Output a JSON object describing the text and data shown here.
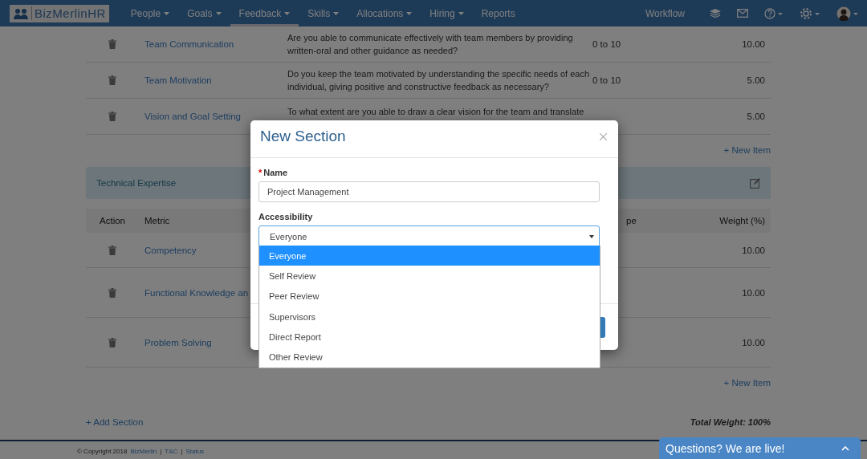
{
  "nav": {
    "logo": "BizMerlinHR",
    "items": [
      {
        "label": "People",
        "dropdown": true,
        "selected": false
      },
      {
        "label": "Goals",
        "dropdown": true,
        "selected": false
      },
      {
        "label": "Feedback",
        "dropdown": true,
        "selected": true
      },
      {
        "label": "Skills",
        "dropdown": true,
        "selected": false
      },
      {
        "label": "Allocations",
        "dropdown": true,
        "selected": false
      },
      {
        "label": "Hiring",
        "dropdown": true,
        "selected": false
      },
      {
        "label": "Reports",
        "dropdown": false,
        "selected": false
      }
    ],
    "workflow": "Workflow"
  },
  "first_section": {
    "rows": [
      {
        "metric": "Team Communication",
        "description": "Are you able to communicate effectively with team members by providing written-oral and other guidance as needed?",
        "scale": "0 to 10",
        "weight": "10.00"
      },
      {
        "metric": "Team Motivation",
        "description": "Do you keep the team motivated by understanding the specific needs of each individual, giving positive and constructive feedback as necessary?",
        "scale": "0 to 10",
        "weight": "5.00"
      },
      {
        "metric": "Vision and Goal Setting",
        "description": "To what extent are you able to draw a clear vision for the team and translate",
        "weight": "5.00"
      }
    ],
    "new_item": "+ New Item"
  },
  "technical_section": {
    "title": "Technical Expertise",
    "columns": [
      "Action",
      "Metric",
      "pe",
      "Weight (%)"
    ],
    "rows": [
      {
        "metric": "Competency",
        "weight": "10.00"
      },
      {
        "metric": "Functional Knowledge an",
        "weight": "10.00"
      },
      {
        "metric": "Problem Solving",
        "weight": "10.00"
      }
    ],
    "new_item": "+ New Item"
  },
  "add_section": "+ Add Section",
  "total_weight": "Total Weight: 100%",
  "footer": {
    "copyright": "© Copyright 2018",
    "links": [
      "BizMerlin",
      "T&C",
      "Status"
    ],
    "separator": "|"
  },
  "modal": {
    "title": "New Section",
    "required_mark": "*",
    "name_label": "Name",
    "name_value": "Project Management",
    "access_label": "Accessibility",
    "access_value": "Everyone",
    "options": [
      {
        "label": "Everyone",
        "selected": true
      },
      {
        "label": "Self Review",
        "selected": false
      },
      {
        "label": "Peer Review",
        "selected": false
      },
      {
        "label": "Supervisors",
        "selected": false
      },
      {
        "label": "Direct Report",
        "selected": false
      },
      {
        "label": "Other Review",
        "selected": false
      }
    ]
  },
  "chat": {
    "label": "Questions? We are live!"
  }
}
